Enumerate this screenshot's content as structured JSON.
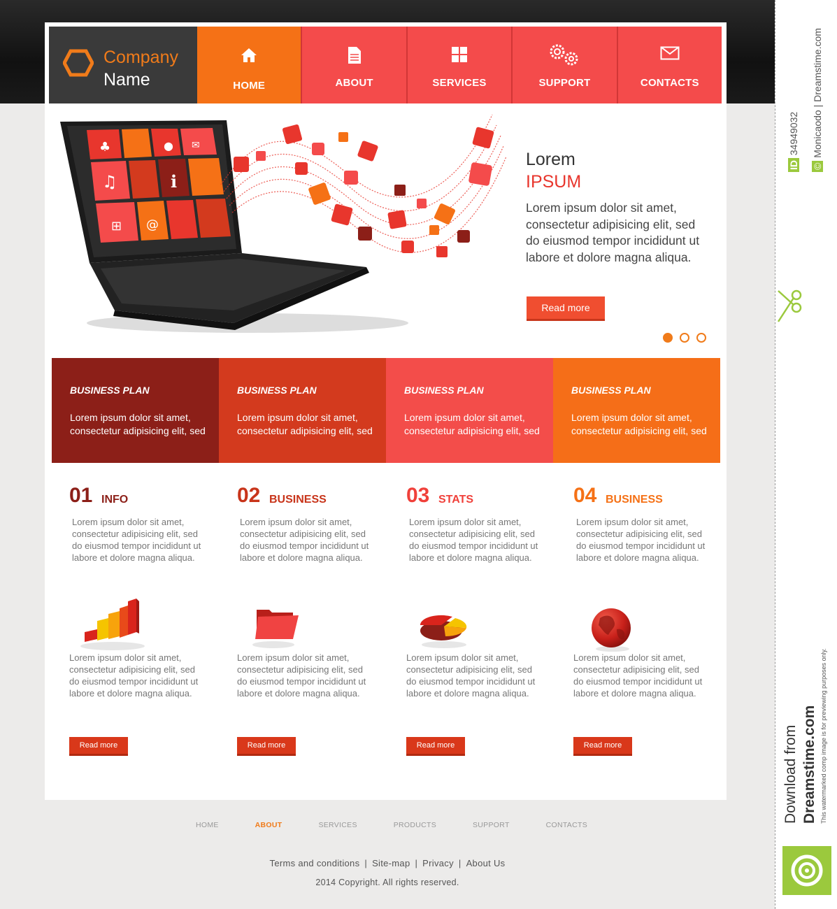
{
  "logo": {
    "line1": "Company",
    "line2": "Name"
  },
  "nav": [
    {
      "label": "HOME",
      "icon": "home-icon",
      "active": true
    },
    {
      "label": "ABOUT",
      "icon": "document-icon"
    },
    {
      "label": "SERVICES",
      "icon": "grid-icon"
    },
    {
      "label": "SUPPORT",
      "icon": "gears-icon"
    },
    {
      "label": "CONTACTS",
      "icon": "envelope-icon"
    }
  ],
  "hero": {
    "title": "Lorem",
    "subtitle": "IPSUM",
    "text": "Lorem ipsum dolor sit amet, consectetur adipisicing elit, sed do eiusmod tempor incididunt ut labore et dolore magna aliqua.",
    "button": "Read more",
    "slides_total": 3,
    "slide_active": 1
  },
  "plans": [
    {
      "title": "BUSINESS PLAN",
      "text": "Lorem ipsum dolor sit amet, consectetur adipisicing elit, sed",
      "color": "#8c1f18"
    },
    {
      "title": "BUSINESS PLAN",
      "text": "Lorem ipsum dolor sit amet, consectetur adipisicing elit, sed",
      "color": "#d33a1e"
    },
    {
      "title": "BUSINESS PLAN",
      "text": "Lorem ipsum dolor sit amet, consectetur adipisicing elit, sed",
      "color": "#f34d4a"
    },
    {
      "title": "BUSINESS PLAN",
      "text": "Lorem ipsum dolor sit amet, consectetur adipisicing elit, sed",
      "color": "#f56e18"
    }
  ],
  "features": [
    {
      "num": "01",
      "name": "INFO",
      "color": "#8c1f18",
      "icon": "bar-chart-icon",
      "text1": "Lorem ipsum dolor sit amet, consectetur adipisicing elit, sed do eiusmod tempor incididunt ut labore et dolore magna aliqua.",
      "text2": "Lorem ipsum dolor sit amet, consectetur adipisicing elit, sed do eiusmod tempor incididunt ut labore et dolore magna aliqua.",
      "button": "Read more"
    },
    {
      "num": "02",
      "name": "BUSINESS",
      "color": "#c8341a",
      "icon": "folder-icon",
      "text1": "Lorem ipsum dolor sit amet, consectetur adipisicing elit, sed do eiusmod tempor incididunt ut labore et dolore magna aliqua.",
      "text2": "Lorem ipsum dolor sit amet, consectetur adipisicing elit, sed do eiusmod tempor incididunt ut labore et dolore magna aliqua.",
      "button": "Read more"
    },
    {
      "num": "03",
      "name": "STATS",
      "color": "#f0403a",
      "icon": "pie-chart-icon",
      "text1": "Lorem ipsum dolor sit amet, consectetur adipisicing elit, sed do eiusmod tempor incididunt ut labore et dolore magna aliqua.",
      "text2": "Lorem ipsum dolor sit amet, consectetur adipisicing elit, sed do eiusmod tempor incididunt ut labore et dolore magna aliqua.",
      "button": "Read more"
    },
    {
      "num": "04",
      "name": "BUSINESS",
      "color": "#f57116",
      "icon": "globe-icon",
      "text1": "Lorem ipsum dolor sit amet, consectetur adipisicing elit, sed do eiusmod tempor incididunt ut labore et dolore magna aliqua.",
      "text2": "Lorem ipsum dolor sit amet, consectetur adipisicing elit, sed do eiusmod tempor incididunt ut labore et dolore magna aliqua.",
      "button": "Read more"
    }
  ],
  "footer": {
    "nav": [
      "HOME",
      "ABOUT",
      "SERVICES",
      "PRODUCTS",
      "SUPPORT",
      "CONTACTS"
    ],
    "active_nav": "ABOUT",
    "links": [
      "Terms and conditions",
      "Site-map",
      "Privacy",
      "About Us"
    ],
    "copyright": "2014  Copyright. All rights reserved."
  },
  "stock": {
    "id": "34949032",
    "author": "Monicaodo | Dreamstime.com",
    "download": "Download from",
    "site": "Dreamstime.com",
    "note": "This watermarked comp image is for previewing purposes only."
  },
  "colors": {
    "accent": "#f57116",
    "red": "#f44b4b",
    "dark": "#3a3a3a"
  }
}
